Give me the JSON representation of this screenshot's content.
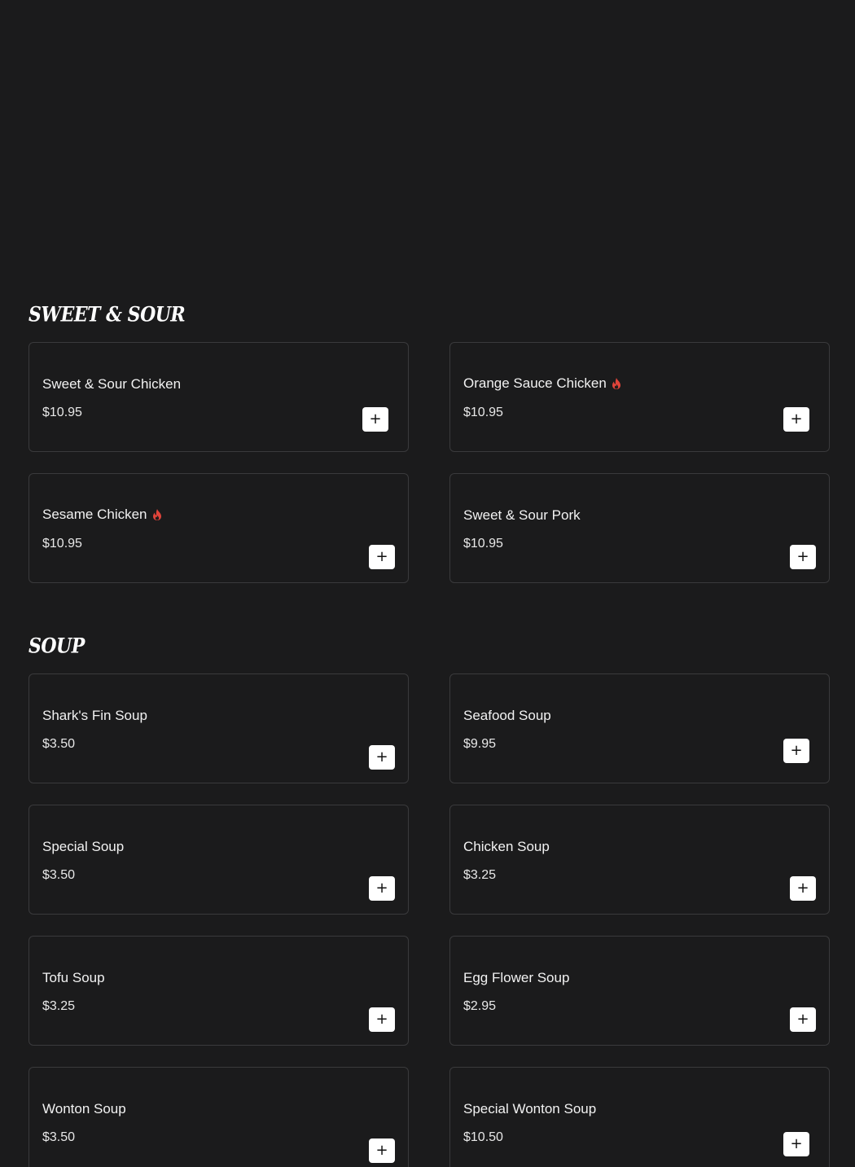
{
  "sections": [
    {
      "title": "SWEET & SOUR",
      "items": [
        {
          "name": "Sweet & Sour Chicken",
          "price": "$10.95",
          "spicy": false
        },
        {
          "name": "Orange Sauce Chicken",
          "price": "$10.95",
          "spicy": true
        },
        {
          "name": "Sesame Chicken",
          "price": "$10.95",
          "spicy": true
        },
        {
          "name": "Sweet & Sour Pork",
          "price": "$10.95",
          "spicy": false
        }
      ]
    },
    {
      "title": "SOUP",
      "items": [
        {
          "name": "Shark's Fin Soup",
          "price": "$3.50",
          "spicy": false
        },
        {
          "name": "Seafood Soup",
          "price": "$9.95",
          "spicy": false
        },
        {
          "name": "Special Soup",
          "price": "$3.50",
          "spicy": false
        },
        {
          "name": "Chicken Soup",
          "price": "$3.25",
          "spicy": false
        },
        {
          "name": "Tofu Soup",
          "price": "$3.25",
          "spicy": false
        },
        {
          "name": "Egg Flower Soup",
          "price": "$2.95",
          "spicy": false
        },
        {
          "name": "Wonton Soup",
          "price": "$3.50",
          "spicy": false
        },
        {
          "name": "Special Wonton Soup",
          "price": "$10.50",
          "spicy": false
        }
      ]
    }
  ],
  "add_button_label": "+",
  "icons": {
    "spicy": "flame-icon",
    "add": "plus-icon"
  },
  "colors": {
    "background": "#1b1b1c",
    "card_border": "#3a3a3c",
    "spicy": "#e0443a",
    "button_bg": "#ffffff"
  }
}
